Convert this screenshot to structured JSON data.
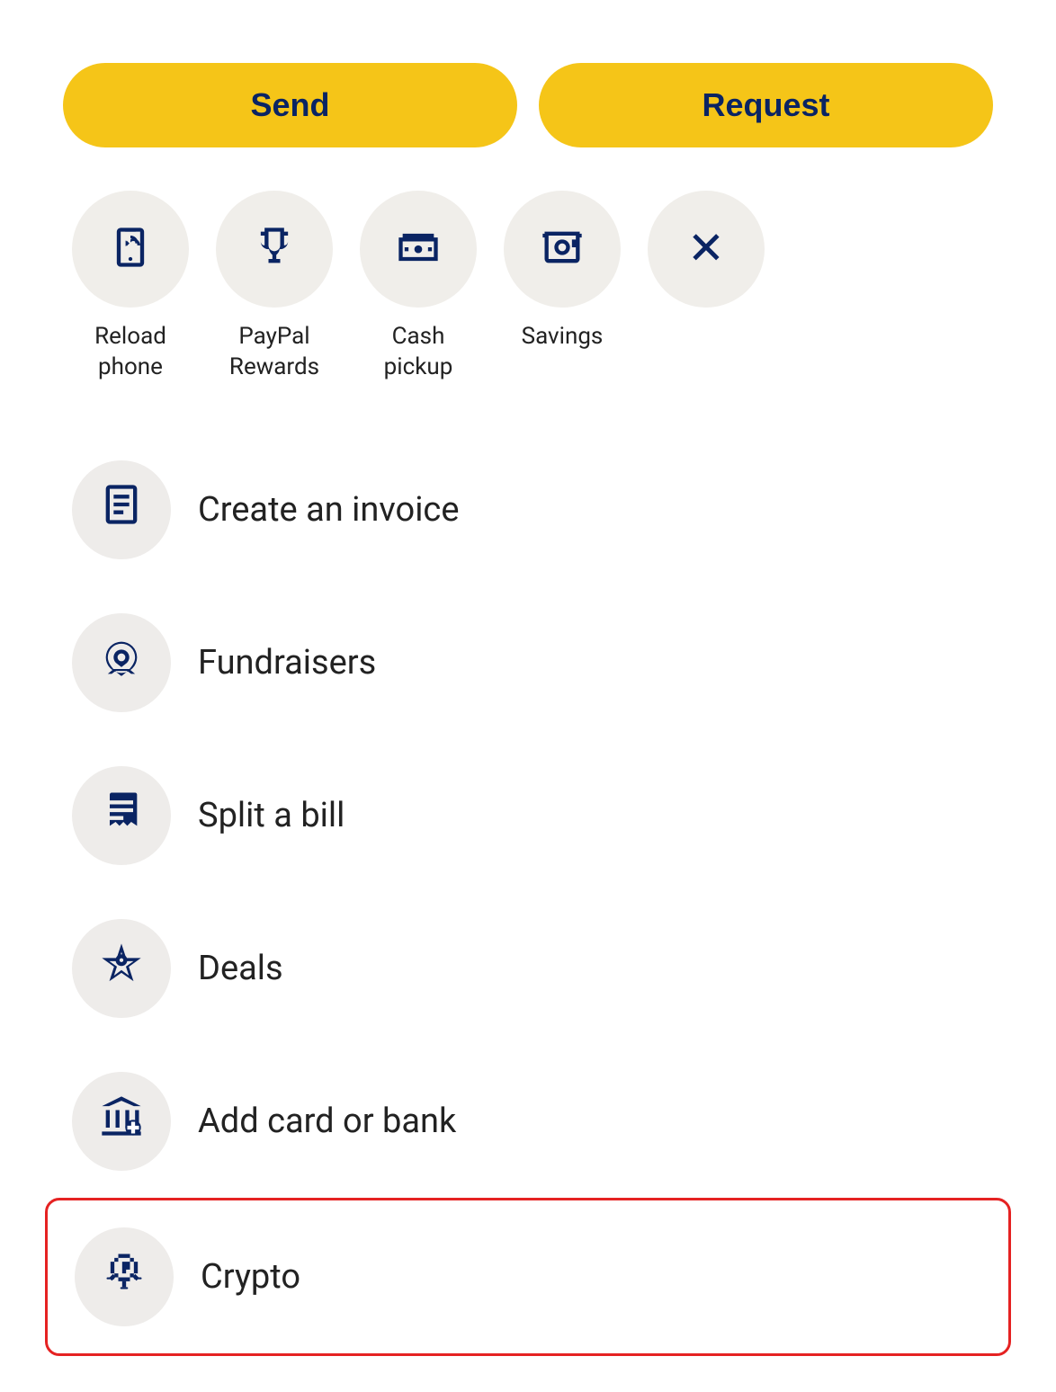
{
  "buttons": {
    "send_label": "Send",
    "request_label": "Request"
  },
  "quick_actions": [
    {
      "id": "reload-phone",
      "label": "Reload\nphone",
      "icon": "reload"
    },
    {
      "id": "paypal-rewards",
      "label": "PayPal\nRewards",
      "icon": "trophy"
    },
    {
      "id": "cash-pickup",
      "label": "Cash\npickup",
      "icon": "cash"
    },
    {
      "id": "savings",
      "label": "Savings",
      "icon": "savings"
    },
    {
      "id": "close",
      "label": "",
      "icon": "close"
    }
  ],
  "menu_items": [
    {
      "id": "create-invoice",
      "label": "Create an invoice",
      "icon": "invoice",
      "highlighted": false
    },
    {
      "id": "fundraisers",
      "label": "Fundraisers",
      "icon": "fundraiser",
      "highlighted": false
    },
    {
      "id": "split-bill",
      "label": "Split a bill",
      "icon": "bill",
      "highlighted": false
    },
    {
      "id": "deals",
      "label": "Deals",
      "icon": "deals",
      "highlighted": false
    },
    {
      "id": "add-card-bank",
      "label": "Add card or bank",
      "icon": "bank",
      "highlighted": false
    },
    {
      "id": "crypto",
      "label": "Crypto",
      "icon": "crypto",
      "highlighted": true
    }
  ],
  "colors": {
    "brand_yellow": "#F5C518",
    "brand_dark_blue": "#0a2463",
    "icon_bg": "#eeecea",
    "highlight_border": "#e52222"
  }
}
